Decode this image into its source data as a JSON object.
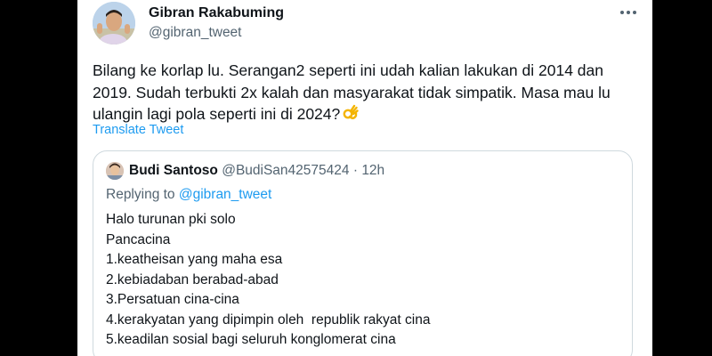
{
  "tweet": {
    "author_name": "Gibran Rakabuming",
    "author_handle": "@gibran_tweet",
    "text": "Bilang ke korlap lu. Serangan2 seperti ini udah kalian lakukan di 2014 dan 2019. Sudah terbukti 2x kalah dan masyarakat tidak simpatik. Masa mau lu ulangin lagi pola seperti ini di 2024?",
    "emoji": "ok-hand-emoji",
    "translate_label": "Translate Tweet"
  },
  "quoted_tweet": {
    "author_name": "Budi Santoso",
    "author_handle": "@BudiSan42575424",
    "separator": "·",
    "time": "12h",
    "replying_prefix": "Replying to",
    "replying_handle": "@gibran_tweet",
    "lines": [
      "Halo turunan pki solo",
      "Pancacina",
      "1.keatheisan yang maha esa",
      "2.kebiadaban berabad-abad",
      "3.Persatuan cina-cina",
      "4.kerakyatan yang dipimpin oleh  republik rakyat cina",
      "5.keadilan sosial bagi seluruh konglomerat cina"
    ]
  },
  "colors": {
    "text_primary": "#0f1419",
    "text_secondary": "#536471",
    "link": "#1d9bf0",
    "border": "#cfd9de",
    "background": "#ffffff",
    "letterbox": "#000000"
  },
  "icons": {
    "more": "more-horizontal-icon",
    "avatar": "profile-photo",
    "emoji": "ok-hand-emoji"
  }
}
